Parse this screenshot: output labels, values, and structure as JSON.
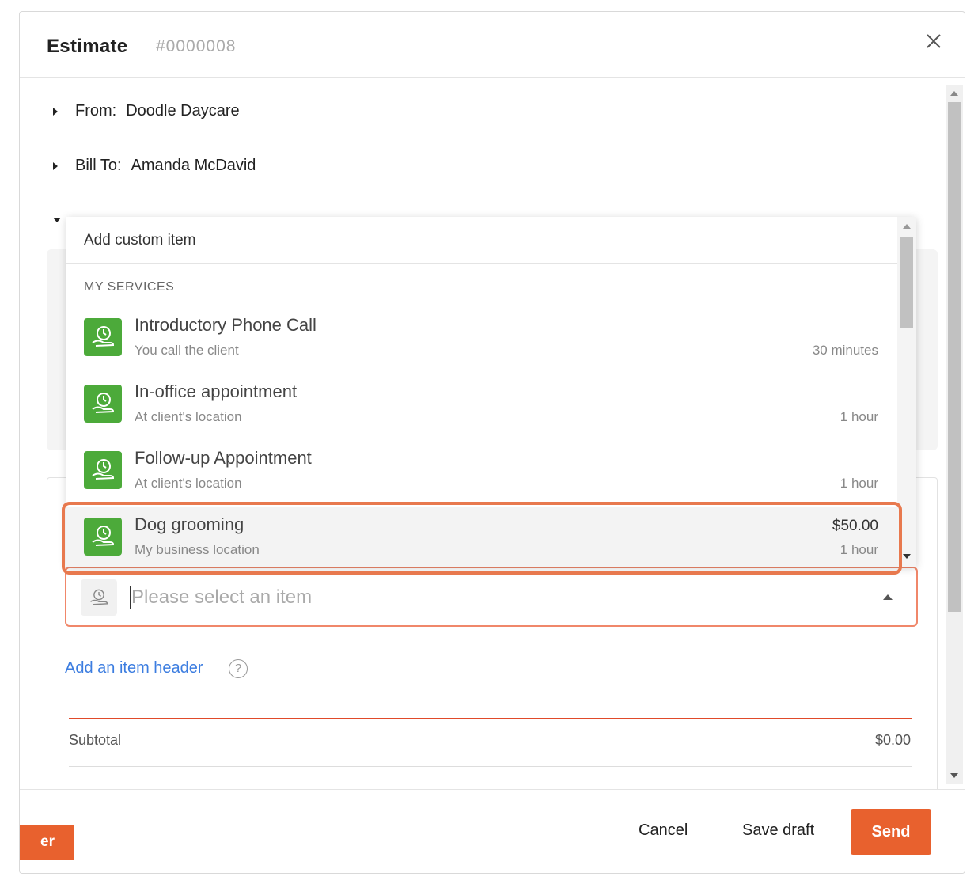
{
  "modal": {
    "title": "Estimate",
    "number": "#0000008"
  },
  "sections": {
    "from_label": "From:",
    "from_value": "Doodle Daycare",
    "bill_label": "Bill To:",
    "bill_value": "Amanda McDavid"
  },
  "dropdown": {
    "custom_item": "Add custom item",
    "group_label": "MY SERVICES",
    "items": [
      {
        "name": "Introductory Phone Call",
        "subtitle": "You call the client",
        "price": "",
        "duration": "30 minutes",
        "icon": "service-hand-clock-icon"
      },
      {
        "name": "In-office appointment",
        "subtitle": "At client's location",
        "price": "",
        "duration": "1 hour",
        "icon": "service-hand-clock-icon"
      },
      {
        "name": "Follow-up Appointment",
        "subtitle": "At client's location",
        "price": "",
        "duration": "1 hour",
        "icon": "service-hand-clock-icon"
      },
      {
        "name": "Dog grooming",
        "subtitle": "My business location",
        "price": "$50.00",
        "duration": "1 hour",
        "icon": "service-hand-clock-icon"
      }
    ]
  },
  "item_select": {
    "placeholder": "Please select an item"
  },
  "add_header_label": "Add an item header",
  "help_glyph": "?",
  "totals": {
    "subtotal_label": "Subtotal",
    "subtotal_value": "$0.00"
  },
  "footer": {
    "partial_label": "er",
    "cancel_label": "Cancel",
    "save_draft_label": "Save draft",
    "send_label": "Send"
  },
  "colors": {
    "accent": "#e8612e",
    "service_icon_bg": "#4caa3a",
    "link": "#3c7de0",
    "highlight": "#e8794e"
  }
}
